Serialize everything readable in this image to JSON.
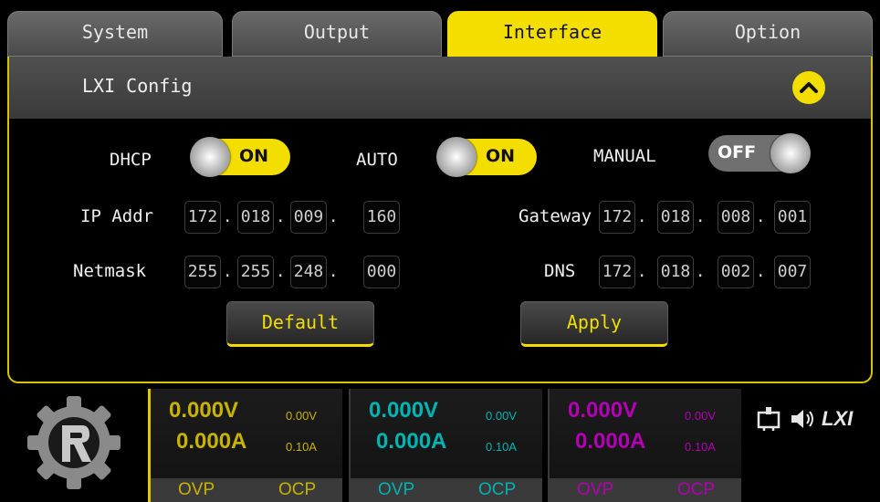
{
  "tabs": [
    {
      "label": "System"
    },
    {
      "label": "Output"
    },
    {
      "label": "Interface",
      "active": true
    },
    {
      "label": "Option"
    }
  ],
  "panel": {
    "title": "LXI Config"
  },
  "modes": {
    "dhcp": {
      "label": "DHCP",
      "state": "ON"
    },
    "auto": {
      "label": "AUTO",
      "state": "ON"
    },
    "manual": {
      "label": "MANUAL",
      "state": "OFF"
    }
  },
  "network": {
    "ip_label": "IP Addr",
    "ip": [
      "172",
      "018",
      "009",
      "160"
    ],
    "netmask_label": "Netmask",
    "netmask": [
      "255",
      "255",
      "248",
      "000"
    ],
    "gateway_label": "Gateway",
    "gateway": [
      "172",
      "018",
      "008",
      "001"
    ],
    "dns_label": "DNS",
    "dns": [
      "172",
      "018",
      "002",
      "007"
    ],
    "separator": "."
  },
  "buttons": {
    "default": "Default",
    "apply": "Apply"
  },
  "channels": [
    {
      "voltage": "0.000V",
      "current": "0.000A",
      "set_voltage": "0.00V",
      "set_current": "0.10A",
      "ovp": "OVP",
      "ocp": "OCP",
      "color": "#c8b400",
      "prot_color": "#c8b400"
    },
    {
      "voltage": "0.000V",
      "current": "0.000A",
      "set_voltage": "0.00V",
      "set_current": "0.10A",
      "ovp": "OVP",
      "ocp": "OCP",
      "color": "#00b4b4",
      "prot_color": "#00b4b4"
    },
    {
      "voltage": "0.000V",
      "current": "0.000A",
      "set_voltage": "0.00V",
      "set_current": "0.10A",
      "ovp": "OVP",
      "ocp": "OCP",
      "color": "#b400b4",
      "prot_color": "#b400b4"
    }
  ],
  "status": {
    "lxi_text": "LXI",
    "icons": [
      "network-icon",
      "speaker-icon",
      "lxi-logo"
    ]
  },
  "colors": {
    "accent": "#f4de00",
    "ch1": "#c8b400",
    "ch2": "#00b4b4",
    "ch3": "#b400b4"
  }
}
